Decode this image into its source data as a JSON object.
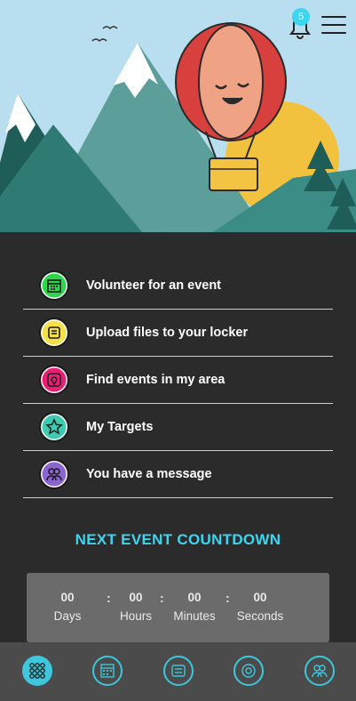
{
  "header": {
    "notifications_count": "5",
    "bell_icon": "bell-icon",
    "menu_icon": "hamburger-menu-icon"
  },
  "actions": [
    {
      "label": "Volunteer for an event",
      "icon": "calendar-icon",
      "color": "#2ed64d"
    },
    {
      "label": "Upload files to your locker",
      "icon": "document-icon",
      "color": "#f4e04a"
    },
    {
      "label": "Find events in my area",
      "icon": "location-pin-icon",
      "color": "#ea1e74"
    },
    {
      "label": "My Targets",
      "icon": "star-icon",
      "color": "#3fcbb1"
    },
    {
      "label": "You have a message",
      "icon": "people-icon",
      "color": "#8a64cf"
    }
  ],
  "countdown": {
    "title": "NEXT EVENT COUNTDOWN",
    "days": "00",
    "hours": "00",
    "minutes": "00",
    "seconds": "00",
    "days_label": "Days",
    "hours_label": "Hours",
    "minutes_label": "Minutes",
    "seconds_label": "Seconds",
    "separator": ":"
  },
  "tabbar": {
    "items": [
      {
        "name": "home-grid-icon",
        "active": true
      },
      {
        "name": "calendar-icon",
        "active": false
      },
      {
        "name": "document-icon",
        "active": false
      },
      {
        "name": "target-icon",
        "active": false
      },
      {
        "name": "people-icon",
        "active": false
      }
    ],
    "accent": "#3dc7dc"
  },
  "colors": {
    "accent": "#3dd6f0",
    "background": "#2b2b2b",
    "countdown_bg": "#6b6b6b"
  }
}
